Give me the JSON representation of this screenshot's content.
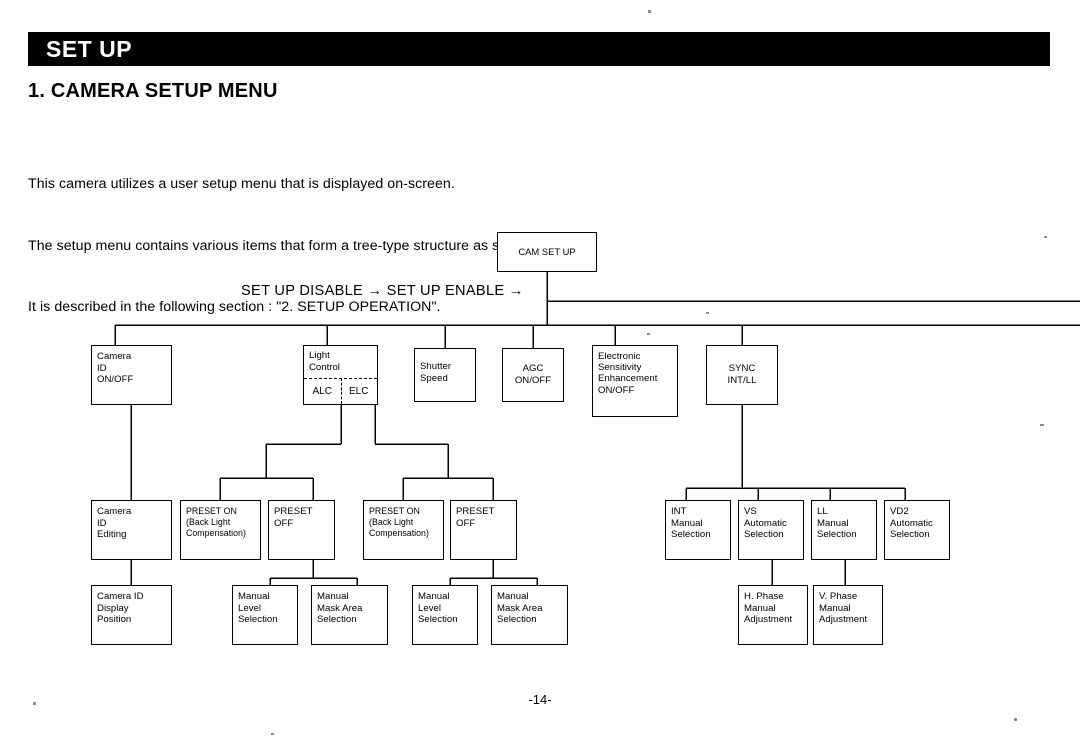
{
  "document": {
    "banner_title": "SET UP",
    "section_heading": "1. CAMERA SETUP MENU",
    "paragraph": [
      "This camera utilizes a user setup menu that is displayed on-screen.",
      "The setup menu contains various items that form a tree-type structure as shown below.",
      "It is described in the following section : \"2. SETUP OPERATION\"."
    ],
    "page_number": "-14-"
  },
  "diagram": {
    "root_label": "CAM SET UP",
    "flow_label": "SET UP DISABLE → SET UP ENABLE →",
    "level1": [
      {
        "lines": [
          "Camera",
          "ID",
          "ON/OFF"
        ]
      },
      {
        "lines": [
          "Light",
          "Control"
        ],
        "cells": [
          "ALC",
          "ELC"
        ]
      },
      {
        "lines": [
          "Shutter",
          "Speed"
        ]
      },
      {
        "lines": [
          "AGC",
          "ON/OFF"
        ]
      },
      {
        "lines": [
          "Electronic",
          "Sensitivity",
          "Enhancement",
          "ON/OFF"
        ]
      },
      {
        "lines": [
          "SYNC",
          "INT/LL"
        ]
      }
    ],
    "level2": [
      {
        "lines": [
          "Camera",
          "ID",
          "Editing"
        ]
      },
      {
        "lines": [
          "PRESET ON",
          "(Back Light",
          "Compensation)"
        ]
      },
      {
        "lines": [
          "PRESET",
          "OFF"
        ]
      },
      {
        "lines": [
          "PRESET ON",
          "(Back Light",
          "Compensation)"
        ]
      },
      {
        "lines": [
          "PRESET",
          "OFF"
        ]
      },
      {
        "lines": [
          "INT",
          "Manual",
          "Selection"
        ]
      },
      {
        "lines": [
          "VS",
          "Automatic",
          "Selection"
        ]
      },
      {
        "lines": [
          "LL",
          "Manual",
          "Selection"
        ]
      },
      {
        "lines": [
          "VD2",
          "Automatic",
          "Selection"
        ]
      }
    ],
    "level3": [
      {
        "lines": [
          "Camera ID",
          "Display",
          "Position"
        ]
      },
      {
        "lines": [
          "Manual",
          "Level",
          "Selection"
        ]
      },
      {
        "lines": [
          "Manual",
          "Mask Area",
          "Selection"
        ]
      },
      {
        "lines": [
          "Manual",
          "Level",
          "Selection"
        ]
      },
      {
        "lines": [
          "Manual",
          "Mask Area",
          "Selection"
        ]
      },
      {
        "lines": [
          "H. Phase",
          "Manual",
          "Adjustment"
        ]
      },
      {
        "lines": [
          "V. Phase",
          "Manual",
          "Adjustment"
        ]
      }
    ]
  },
  "colors": {
    "ink": "#000000",
    "paper": "#ffffff"
  }
}
